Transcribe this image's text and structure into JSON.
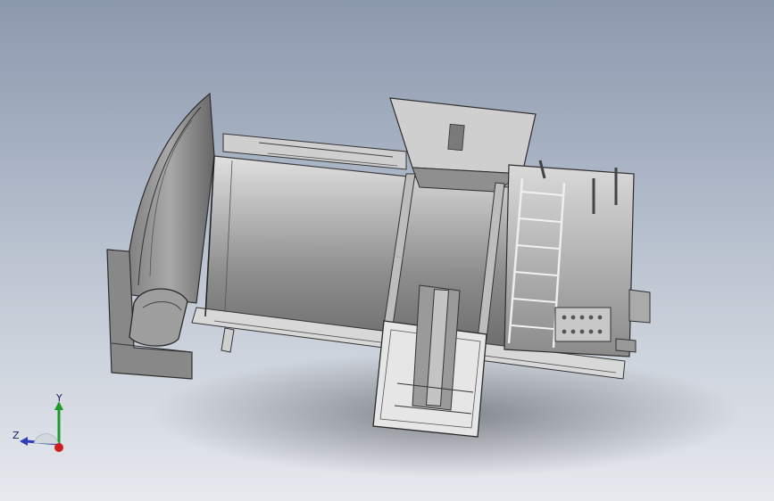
{
  "viewport": {
    "background_top": "#8c99ad",
    "background_bottom": "#e6e9ee"
  },
  "triad": {
    "x_color": "#d01c1c",
    "y_color": "#1f9a28",
    "z_color": "#2c3fb8",
    "y_label": "Y",
    "z_label": "Z"
  }
}
